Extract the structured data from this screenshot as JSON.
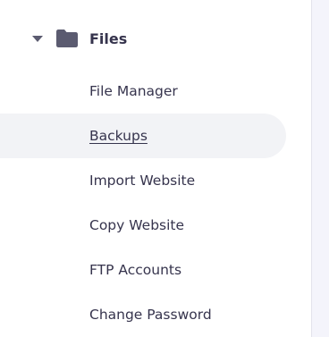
{
  "sidebar": {
    "group": {
      "title": "Files",
      "caret_icon": "caret-down-icon",
      "folder_icon": "folder-icon",
      "expanded": true
    },
    "items": [
      {
        "label": "File Manager",
        "active": false
      },
      {
        "label": "Backups",
        "active": true
      },
      {
        "label": "Import Website",
        "active": false
      },
      {
        "label": "Copy Website",
        "active": false
      },
      {
        "label": "FTP Accounts",
        "active": false
      },
      {
        "label": "Change Password",
        "active": false
      }
    ]
  },
  "colors": {
    "text": "#36344d",
    "icon": "#5b5b70",
    "active_bg": "#f2f3f6",
    "content_bg": "#f4f4fb"
  }
}
